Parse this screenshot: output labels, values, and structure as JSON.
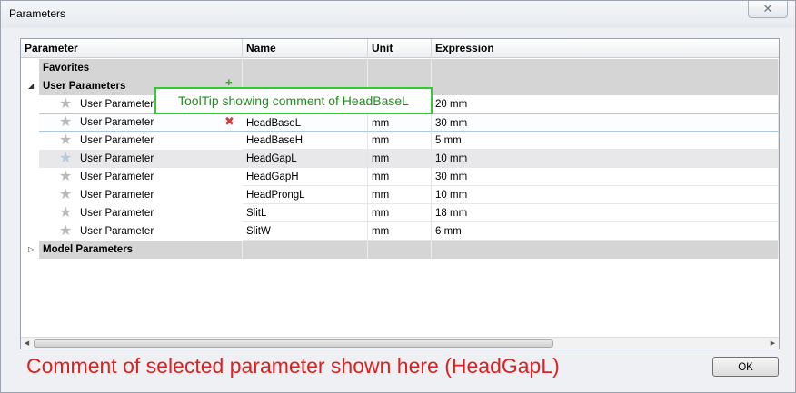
{
  "window": {
    "title": "Parameters",
    "close_symbol": "✕"
  },
  "table": {
    "columns": [
      "Parameter",
      "Name",
      "Unit",
      "Expression"
    ],
    "groups": [
      {
        "label": "Favorites",
        "expander": ""
      },
      {
        "label": "User Parameters",
        "expander": "◢"
      },
      {
        "label": "Model Parameters",
        "expander": "▷"
      }
    ],
    "rows": [
      {
        "param": "User Parameter",
        "name": "",
        "unit": "",
        "expression": "20 mm"
      },
      {
        "param": "User Parameter",
        "name": "HeadBaseL",
        "unit": "mm",
        "expression": "30 mm"
      },
      {
        "param": "User Parameter",
        "name": "HeadBaseH",
        "unit": "mm",
        "expression": "5 mm"
      },
      {
        "param": "User Parameter",
        "name": "HeadGapL",
        "unit": "mm",
        "expression": "10 mm"
      },
      {
        "param": "User Parameter",
        "name": "HeadGapH",
        "unit": "mm",
        "expression": "30 mm"
      },
      {
        "param": "User Parameter",
        "name": "HeadProngL",
        "unit": "mm",
        "expression": "10 mm"
      },
      {
        "param": "User Parameter",
        "name": "SlitL",
        "unit": "mm",
        "expression": "18 mm"
      },
      {
        "param": "User Parameter",
        "name": "SlitW",
        "unit": "mm",
        "expression": "6 mm"
      }
    ]
  },
  "icons": {
    "star": "★",
    "plus": "+",
    "delete": "✖",
    "scroll_left": "◀",
    "scroll_right": "▶"
  },
  "tooltip": {
    "text": "ToolTip showing comment of HeadBaseL"
  },
  "comment": {
    "text": "Comment of selected parameter shown here (HeadGapL)"
  },
  "ok_label": "OK",
  "colors": {
    "tooltip_border": "#2ecc2e",
    "comment_text": "#dd2020",
    "group_bg": "#d5d5d5",
    "delete_icon": "#d23a3a",
    "add_icon": "#3aa33a"
  }
}
